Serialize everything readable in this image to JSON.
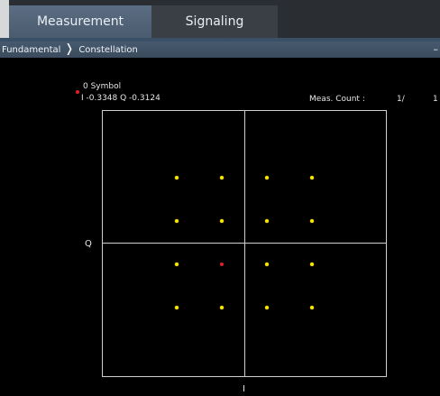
{
  "tabs": [
    {
      "label": "Measurement",
      "active": true
    },
    {
      "label": "Signaling",
      "active": false
    }
  ],
  "breadcrumb": {
    "items": [
      "Fundamental",
      "Constellation"
    ],
    "separator": "❭",
    "collapse_symbol": "–"
  },
  "marker": {
    "symbol_label": "0 Symbol",
    "iq_readout": "I -0.3348 Q -0.3124",
    "color": "#e02020"
  },
  "meas_count": {
    "label": "Meas. Count :",
    "value": "1/",
    "total": "1"
  },
  "chart_data": {
    "type": "scatter",
    "xlabel": "I",
    "ylabel": "Q",
    "point_color": "#f4e600",
    "selected_color": "#e02020",
    "points": [
      {
        "x": -3,
        "y": 3
      },
      {
        "x": -1,
        "y": 3
      },
      {
        "x": 1,
        "y": 3
      },
      {
        "x": 3,
        "y": 3
      },
      {
        "x": -3,
        "y": 1
      },
      {
        "x": -1,
        "y": 1
      },
      {
        "x": 1,
        "y": 1
      },
      {
        "x": 3,
        "y": 1
      },
      {
        "x": -3,
        "y": -1
      },
      {
        "x": -1,
        "y": -1,
        "selected": true
      },
      {
        "x": 1,
        "y": -1
      },
      {
        "x": 3,
        "y": -1
      },
      {
        "x": -3,
        "y": -3
      },
      {
        "x": -1,
        "y": -3
      },
      {
        "x": 1,
        "y": -3
      },
      {
        "x": 3,
        "y": -3
      }
    ]
  }
}
